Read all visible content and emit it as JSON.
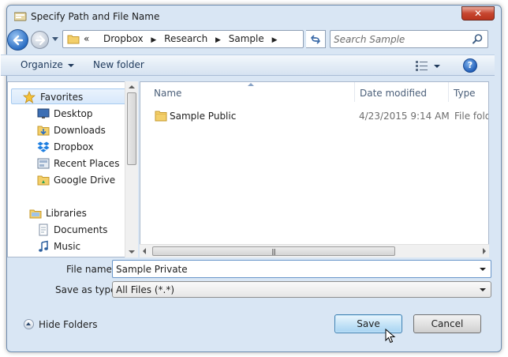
{
  "window": {
    "title": "Specify Path and File Name",
    "close_label": "✕"
  },
  "address": {
    "overflow": "«",
    "crumbs": [
      "Dropbox",
      "Research",
      "Sample"
    ],
    "separator": "▶"
  },
  "search": {
    "placeholder": "Search Sample"
  },
  "toolbar": {
    "organize_label": "Organize",
    "new_folder_label": "New folder",
    "help_label": "?"
  },
  "nav": {
    "items": [
      {
        "label": "Favorites",
        "icon": "star-icon"
      },
      {
        "label": "Desktop",
        "icon": "desktop-icon"
      },
      {
        "label": "Downloads",
        "icon": "downloads-folder-icon"
      },
      {
        "label": "Dropbox",
        "icon": "dropbox-icon"
      },
      {
        "label": "Recent Places",
        "icon": "recent-places-icon"
      },
      {
        "label": "Google Drive",
        "icon": "google-drive-icon"
      },
      {
        "label": "Libraries",
        "icon": "libraries-icon"
      },
      {
        "label": "Documents",
        "icon": "documents-icon"
      },
      {
        "label": "Music",
        "icon": "music-icon"
      }
    ]
  },
  "files": {
    "columns": {
      "name": "Name",
      "date": "Date modified",
      "type": "Type"
    },
    "rows": [
      {
        "name": "Sample Public",
        "date": "4/23/2015 9:14 AM",
        "type": "File folder"
      }
    ],
    "scroll_grip": "|||"
  },
  "form": {
    "filename_label": "File name:",
    "filename_value": "Sample Private",
    "type_label": "Save as type:",
    "type_value": "All Files (*.*)"
  },
  "footer": {
    "hide_folders_label": "Hide Folders",
    "save_label": "Save",
    "cancel_label": "Cancel"
  },
  "colors": {
    "window_frame": "#d9e6f4",
    "close_red": "#c7462f",
    "save_blue": "#c6e4f7",
    "selection": "#d7e8fb"
  }
}
